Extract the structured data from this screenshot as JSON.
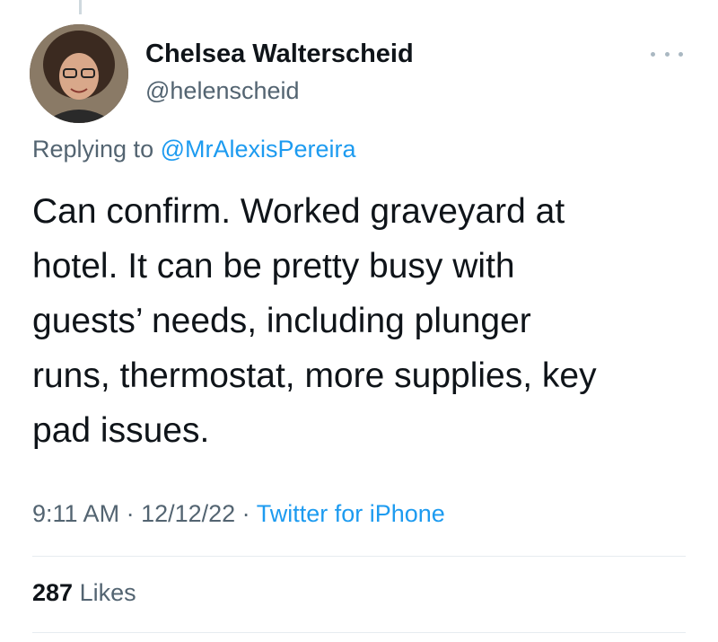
{
  "author": {
    "name": "Chelsea Walterscheid",
    "handle": "@helenscheid"
  },
  "reply": {
    "prefix": "Replying to",
    "mention": "@MrAlexisPereira"
  },
  "tweet": {
    "lines": [
      "Can confirm. Worked graveyard at",
      "hotel. It can be pretty busy with",
      "guests’ needs, including plunger",
      "runs, thermostat, more supplies, key",
      "pad issues."
    ]
  },
  "meta": {
    "time": "9:11 AM",
    "sep1": " · ",
    "date": "12/12/22",
    "sep2": " · ",
    "source": "Twitter for iPhone"
  },
  "stats": {
    "likes_count": "287",
    "likes_label": "Likes"
  },
  "icons": {
    "more": "more-options-icon"
  },
  "colors": {
    "link": "#1d9bf0",
    "text": "#0f1419",
    "secondary": "#536471",
    "divider": "#e6ecf0"
  }
}
